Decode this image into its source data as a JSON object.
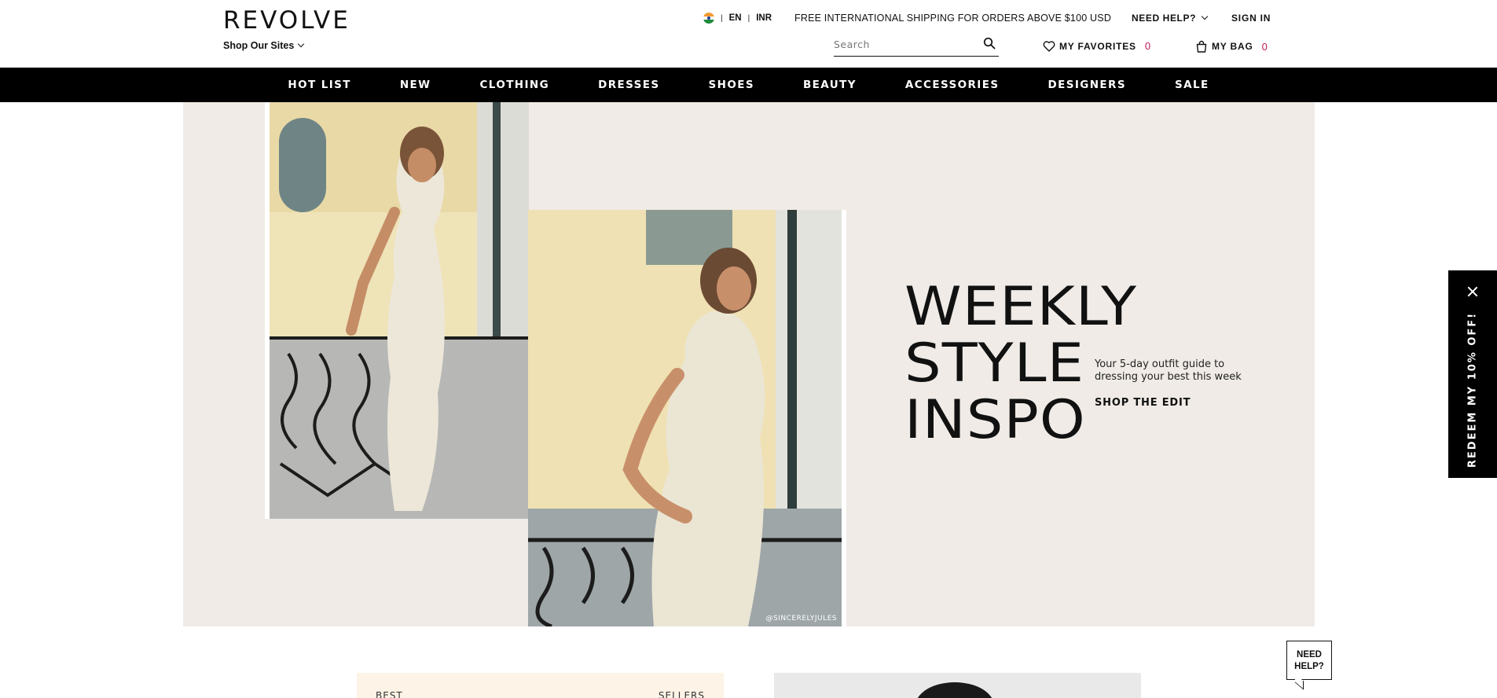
{
  "header": {
    "logo": "REVOLVE",
    "shop_sites": "Shop Our Sites",
    "language": "EN",
    "currency": "INR",
    "shipping": "FREE INTERNATIONAL SHIPPING FOR ORDERS ABOVE $100 USD",
    "need_help": "NEED HELP?",
    "sign_in": "SIGN IN",
    "search_placeholder": "Search",
    "favorites_label": "MY FAVORITES",
    "favorites_count": "0",
    "bag_label": "MY BAG",
    "bag_count": "0"
  },
  "nav": {
    "items": [
      "HOT LIST",
      "NEW",
      "CLOTHING",
      "DRESSES",
      "SHOES",
      "BEAUTY",
      "ACCESSORIES",
      "DESIGNERS",
      "SALE"
    ]
  },
  "hero": {
    "title_lines": [
      "WEEKLY",
      "STYLE",
      "INSPO"
    ],
    "subtitle": "Your 5-day outfit guide to dressing your best this week",
    "cta": "SHOP THE EDIT",
    "photo_credit": "@SINCERELYJULES",
    "background": "#f0ebe6"
  },
  "promo": {
    "text": "REDEEM MY 10% OFF!"
  },
  "lower": {
    "best_left": "BEST",
    "best_right": "SELLERS"
  },
  "help_bubble": {
    "line1": "NEED",
    "line2": "HELP?"
  },
  "colors": {
    "accent_count": "#c2185b",
    "nav_bg": "#000000"
  }
}
